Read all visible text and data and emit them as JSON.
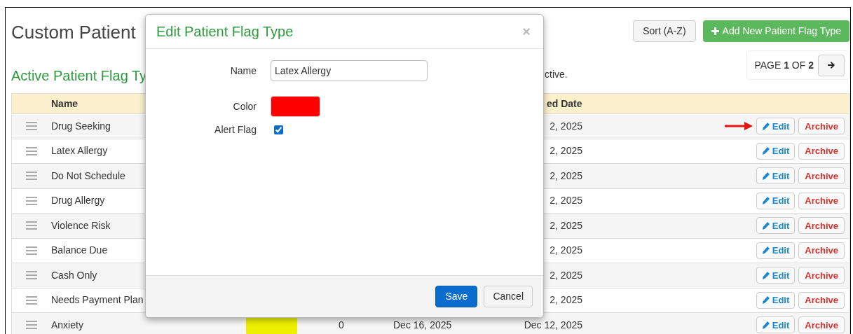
{
  "page": {
    "title": "Custom Patient",
    "sort_button": "Sort (A-Z)",
    "add_button": "Add New Patient Flag Type",
    "subtitle": "Active Patient Flag Ty",
    "description": "ctive.",
    "pagination": "PAGE **1** OF **2**"
  },
  "table": {
    "columns": [
      "Name",
      "ed Date"
    ],
    "rows": [
      {
        "name": "Drug Seeking",
        "modified": "2, 2025",
        "pointer": true,
        "actions": [
          "Edit",
          "Archive"
        ]
      },
      {
        "name": "Latex Allergy",
        "modified": "2, 2025",
        "pointer": false,
        "actions": [
          "Edit",
          "Archive"
        ]
      },
      {
        "name": "Do Not Schedule",
        "modified": "2, 2025",
        "pointer": false,
        "actions": [
          "Edit",
          "Archive"
        ]
      },
      {
        "name": "Drug Allergy",
        "modified": "2, 2025",
        "pointer": false,
        "actions": [
          "Edit",
          "Archive"
        ]
      },
      {
        "name": "Violence Risk",
        "modified": "2, 2025",
        "pointer": false,
        "actions": [
          "Edit",
          "Archive"
        ]
      },
      {
        "name": "Balance Due",
        "modified": "2, 2025",
        "pointer": false,
        "actions": [
          "Edit",
          "Archive"
        ]
      },
      {
        "name": "Cash Only",
        "modified": "2, 2025",
        "pointer": false,
        "actions": [
          "Edit",
          "Archive"
        ]
      },
      {
        "name": "Needs Payment Plan",
        "modified": "2, 2025",
        "pointer": false,
        "actions": [
          "Edit",
          "Archive"
        ]
      },
      {
        "name": "Anxiety",
        "color": "#eef000",
        "count": "0",
        "created": "Dec 16, 2025",
        "modified": "Dec 12, 2025",
        "pointer": false,
        "actions": [
          "Edit",
          "Archive"
        ]
      }
    ]
  },
  "modal": {
    "title": "Edit Patient Flag Type",
    "close": "×",
    "fields": [
      {
        "kind": "text",
        "label": "Name",
        "value": "Latex Allergy"
      },
      {
        "kind": "color",
        "label": "Color",
        "color": "#ff0000"
      },
      {
        "kind": "checkbox",
        "label": "Alert Flag",
        "checked": true
      }
    ],
    "save": "Save",
    "cancel": "Cancel"
  }
}
